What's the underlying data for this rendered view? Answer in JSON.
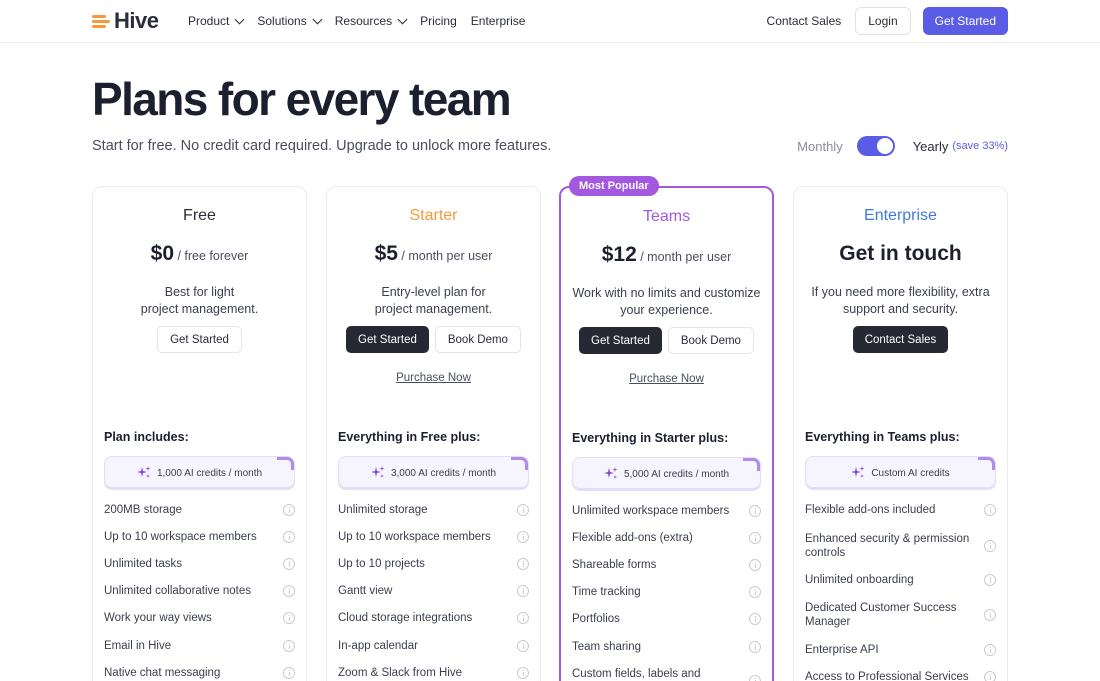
{
  "nav": {
    "brand": "Hive",
    "links": [
      {
        "label": "Product",
        "dropdown": true
      },
      {
        "label": "Solutions",
        "dropdown": true
      },
      {
        "label": "Resources",
        "dropdown": true
      },
      {
        "label": "Pricing",
        "dropdown": false
      },
      {
        "label": "Enterprise",
        "dropdown": false
      }
    ],
    "contact_sales": "Contact Sales",
    "login": "Login",
    "get_started": "Get Started"
  },
  "hero": {
    "title": "Plans for every team",
    "subtitle": "Start for free. No credit card required. Upgrade to unlock more features."
  },
  "billing": {
    "monthly": "Monthly",
    "yearly": "Yearly",
    "save": "(save 33%)",
    "yearly_selected": true
  },
  "colors": {
    "accent": "#5b5ce6",
    "popular": "#a259e0",
    "starter": "#f59a3c",
    "teams": "#a259e0",
    "enterprise": "#3e7be0"
  },
  "plans": [
    {
      "name": "Free",
      "color": "#2a2d3a",
      "amount": "$0",
      "per": " / free forever",
      "desc_lines": [
        "Best for light",
        "project management."
      ],
      "buttons": [
        {
          "label": "Get Started",
          "style": "light"
        }
      ],
      "purchase": "",
      "includes": "Plan includes:",
      "credits": "1,000 AI credits / month",
      "features": [
        "200MB storage",
        "Up to 10 workspace members",
        "Unlimited tasks",
        "Unlimited collaborative notes",
        "Work your way views",
        "Email in Hive",
        "Native chat messaging"
      ]
    },
    {
      "name": "Starter",
      "color": "#f59a3c",
      "amount": "$5",
      "per": " / month per user",
      "desc_lines": [
        "Entry-level plan for",
        "project management."
      ],
      "buttons": [
        {
          "label": "Get Started",
          "style": "dark"
        },
        {
          "label": "Book Demo",
          "style": "light"
        }
      ],
      "purchase": "Purchase Now",
      "includes": "Everything in Free plus:",
      "credits": "3,000 AI credits / month",
      "features": [
        "Unlimited storage",
        "Up to 10 workspace members",
        "Up to 10 projects",
        "Gantt view",
        "Cloud storage integrations",
        "In-app calendar",
        "Zoom & Slack from Hive"
      ]
    },
    {
      "name": "Teams",
      "color": "#a259e0",
      "badge": "Most Popular",
      "amount": "$12",
      "per": " / month per user",
      "desc_lines": [
        "Work with no limits and customize",
        "your experience."
      ],
      "buttons": [
        {
          "label": "Get Started",
          "style": "dark"
        },
        {
          "label": "Book Demo",
          "style": "light"
        }
      ],
      "purchase": "Purchase Now",
      "includes": "Everything in Starter plus:",
      "credits": "5,000 AI credits / month",
      "features": [
        "Unlimited workspace members",
        "Flexible add-ons (extra)",
        "Shareable forms",
        "Time tracking",
        "Portfolios",
        "Team sharing",
        "Custom fields, labels and statuses"
      ]
    },
    {
      "name": "Enterprise",
      "color": "#3e7be0",
      "headline": "Get in touch",
      "desc_lines": [
        "If you need more flexibility, extra",
        "support and security."
      ],
      "buttons": [
        {
          "label": "Contact Sales",
          "style": "dark"
        }
      ],
      "purchase": "",
      "includes": "Everything in Teams plus:",
      "credits": "Custom AI credits",
      "features": [
        "Flexible add-ons included",
        "Enhanced security & permission controls",
        "Unlimited onboarding",
        "Dedicated Customer Success Manager",
        "Enterprise API",
        "Access to Professional Services"
      ]
    }
  ]
}
